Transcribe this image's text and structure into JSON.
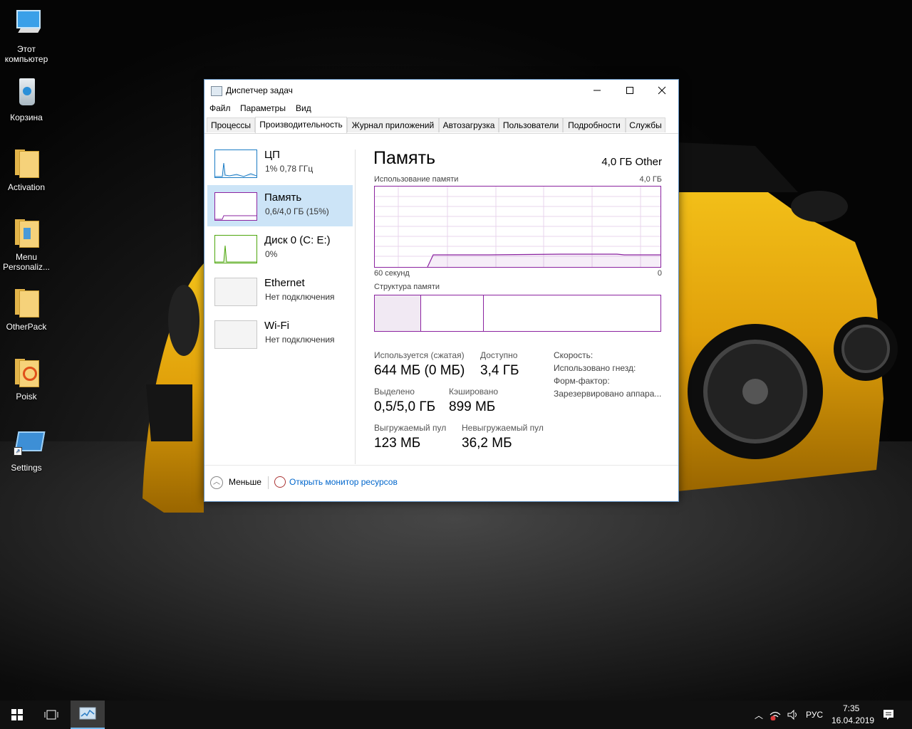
{
  "desktop": {
    "icons": [
      {
        "label": "Этот\nкомпьютер",
        "line1": "Этот",
        "line2": "компьютер"
      },
      {
        "label": "Корзина"
      },
      {
        "label": "Activation"
      },
      {
        "label_line1": "Menu",
        "label_line2": "Personaliz..."
      },
      {
        "label": "OtherPack"
      },
      {
        "label": "Poisk"
      },
      {
        "label": "Settings"
      }
    ]
  },
  "window": {
    "title": "Диспетчер задач",
    "menu": [
      "Файл",
      "Параметры",
      "Вид"
    ],
    "tabs": [
      "Процессы",
      "Производительность",
      "Журнал приложений",
      "Автозагрузка",
      "Пользователи",
      "Подробности",
      "Службы"
    ],
    "active_tab": "Производительность",
    "sidebar": [
      {
        "name": "ЦП",
        "sub": "1% 0,78 ГГц",
        "color": "#1a7bc4"
      },
      {
        "name": "Память",
        "sub": "0,6/4,0 ГБ (15%)",
        "color": "#8b23a0"
      },
      {
        "name": "Диск 0 (C: E:)",
        "sub": "0%",
        "color": "#4da60c"
      },
      {
        "name": "Ethernet",
        "sub": "Нет подключения",
        "color": "#c8c8c8"
      },
      {
        "name": "Wi-Fi",
        "sub": "Нет подключения",
        "color": "#c8c8c8"
      }
    ],
    "panel": {
      "title": "Память",
      "capacity": "4,0 ГБ Other",
      "usage_label": "Использование памяти",
      "usage_max": "4,0 ГБ",
      "time_left": "60 секунд",
      "time_right": "0",
      "structure_label": "Структура памяти",
      "stats": {
        "in_use_label": "Используется (сжатая)",
        "in_use": "644 МБ (0 МБ)",
        "available_label": "Доступно",
        "available": "3,4 ГБ",
        "committed_label": "Выделено",
        "committed": "0,5/5,0 ГБ",
        "cached_label": "Кэшировано",
        "cached": "899 МБ",
        "paged_label": "Выгружаемый пул",
        "paged": "123 МБ",
        "nonpaged_label": "Невыгружаемый пул",
        "nonpaged": "36,2 МБ"
      },
      "info": [
        "Скорость:",
        "Использовано гнезд:",
        "Форм-фактор:",
        "Зарезервировано аппара..."
      ]
    },
    "footer": {
      "less": "Меньше",
      "resource_monitor": "Открыть монитор ресурсов"
    }
  },
  "taskbar": {
    "language": "РУС",
    "time": "7:35",
    "date": "16.04.2019"
  },
  "colors": {
    "memory": "#8b23a0",
    "cpu": "#1a7bc4",
    "disk": "#4da60c",
    "selected": "#cce4f7",
    "link": "#0066cc"
  }
}
